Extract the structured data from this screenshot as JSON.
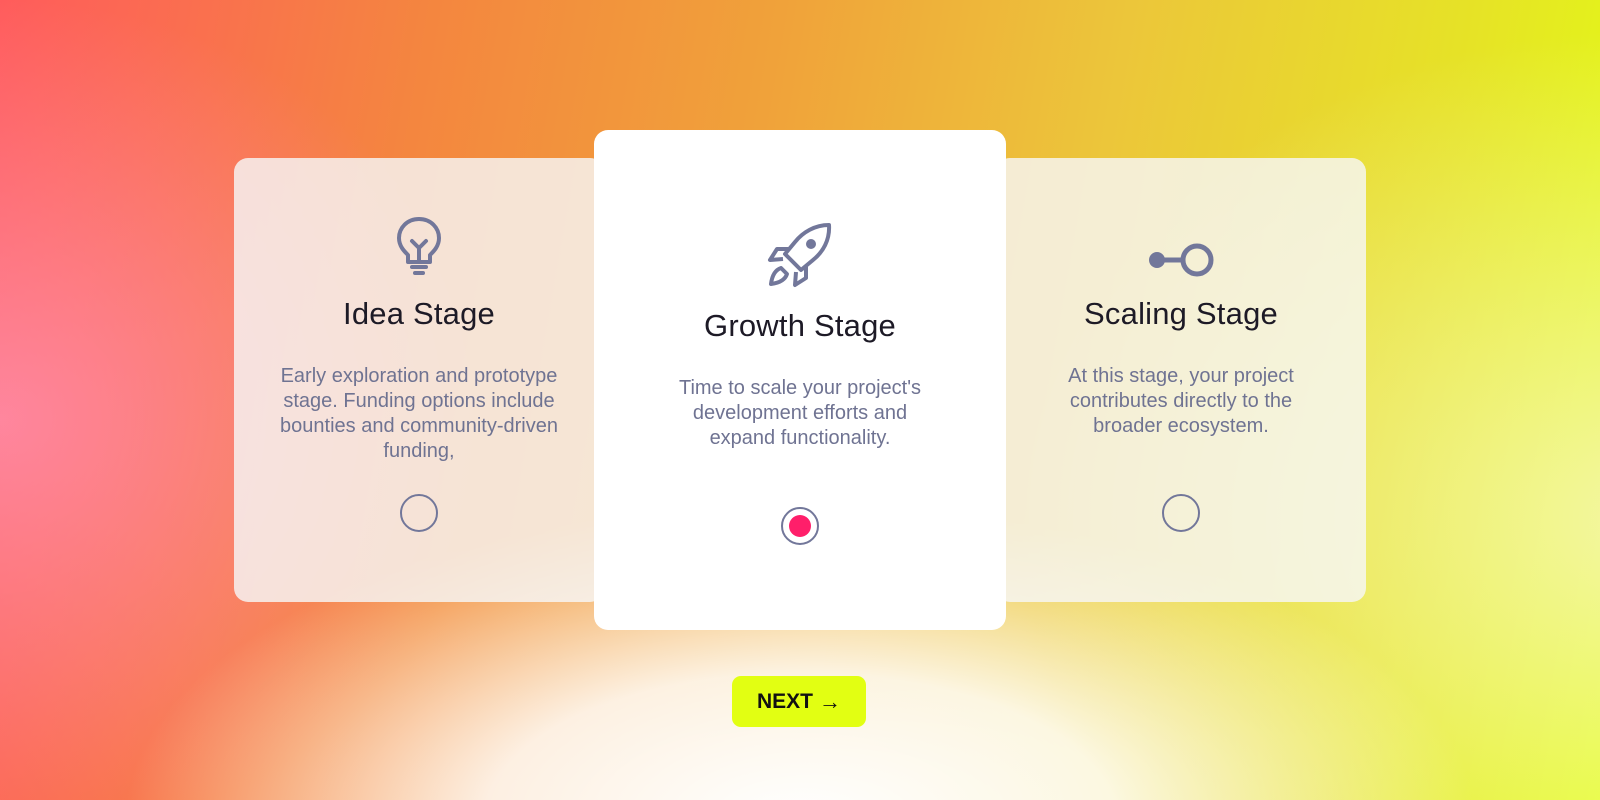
{
  "stages": [
    {
      "title": "Idea Stage",
      "description": "Early exploration and prototype stage. Funding options include bounties and community-driven funding,",
      "icon": "lightbulb-icon",
      "selected": false
    },
    {
      "title": "Growth Stage",
      "description": "Time to scale your project's development efforts and expand functionality.",
      "icon": "rocket-icon",
      "selected": true
    },
    {
      "title": "Scaling Stage",
      "description": "At this stage, your project contributes directly to the broader ecosystem.",
      "icon": "connection-node-icon",
      "selected": false
    }
  ],
  "next_button": {
    "label": "NEXT",
    "arrow": "→"
  },
  "colors": {
    "accent": "#e2ff12",
    "selected_dot": "#ff1f6a",
    "icon": "#72779a",
    "title_text": "#1d1a26",
    "description_text": "#6f7392"
  }
}
